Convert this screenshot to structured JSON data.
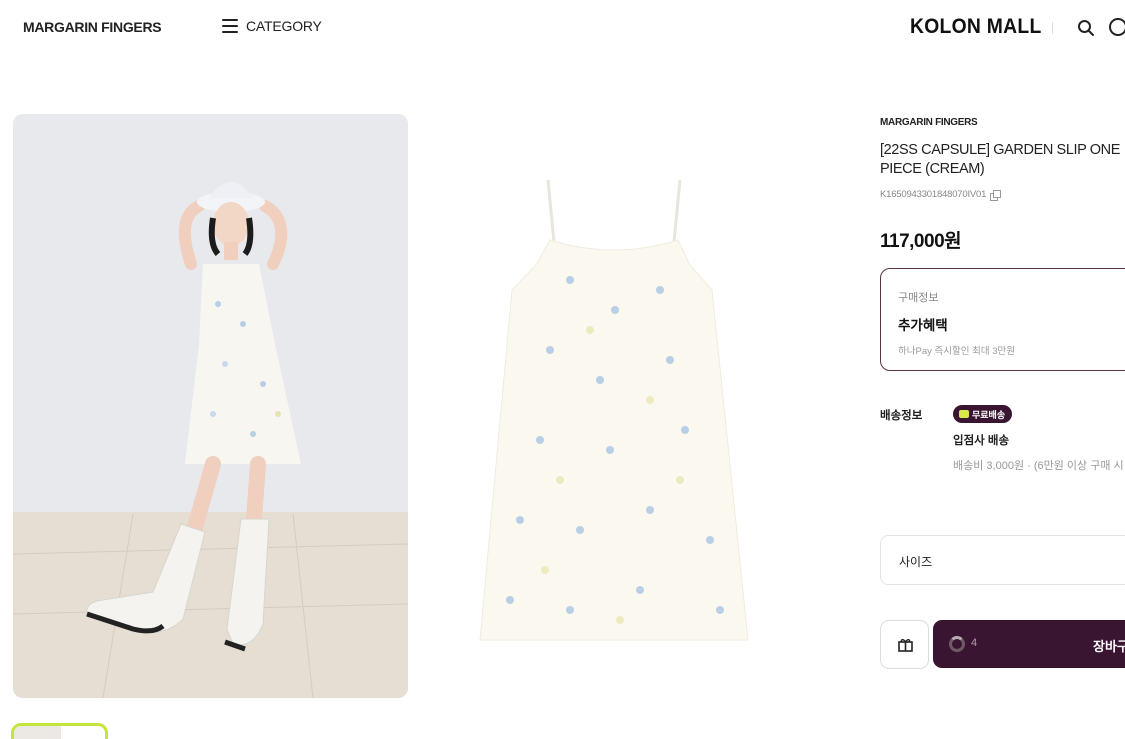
{
  "header": {
    "brand": "MARGARIN FINGERS",
    "category_label": "CATEGORY",
    "mall_logo": "KOLON MALL",
    "icons": [
      "menu-icon",
      "search-icon",
      "user-icon"
    ]
  },
  "product": {
    "brand": "MARGARIN FINGERS",
    "title": "[22SS CAPSULE] GARDEN SLIP ONE PIECE (CREAM)",
    "code": "K1650943301848070IV01",
    "price": "117,000원"
  },
  "benefit": {
    "label": "구매정보",
    "title": "추가혜택",
    "desc": "하나Pay 즉시할인 최대 3만원"
  },
  "shipping": {
    "label": "배송정보",
    "badge": "무료배송",
    "method": "입점사 배송",
    "fee": "배송비 3,000원 · (6만원 이상 구매 시"
  },
  "options": {
    "size_label": "사이즈"
  },
  "actions": {
    "count": "4",
    "cart_label": "장바구"
  },
  "colors": {
    "accent": "#3a1531",
    "thumb_border": "#c4e53c",
    "badge_icon": "#d8e84a"
  }
}
